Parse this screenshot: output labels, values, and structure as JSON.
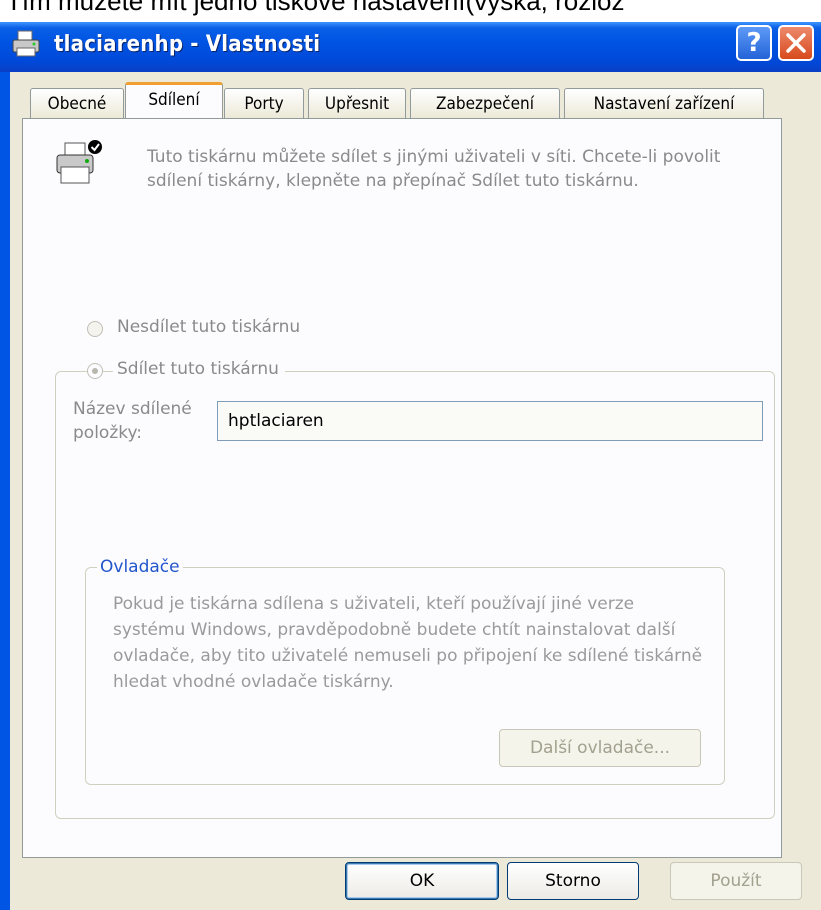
{
  "top_text": "Tím můžete mít jedno tiskové nastavení(výška, rozlož",
  "window": {
    "title": "tlaciarenhp - Vlastnosti",
    "help_label": "?",
    "close_label": "×"
  },
  "tabs": [
    {
      "label": "Obecné",
      "active": false
    },
    {
      "label": "Sdílení",
      "active": true
    },
    {
      "label": "Porty",
      "active": false
    },
    {
      "label": "Upřesnit",
      "active": false
    },
    {
      "label": "Zabezpečení",
      "active": false
    },
    {
      "label": "Nastavení zařízení",
      "active": false
    }
  ],
  "sharing": {
    "info_text": "Tuto tiskárnu můžete sdílet s jinými uživateli v síti. Chcete-li povolit sdílení tiskárny, klepněte na přepínač Sdílet tuto tiskárnu.",
    "radio_no_share": "Nesdílet tuto tiskárnu",
    "radio_share": "Sdílet tuto tiskárnu",
    "share_name_label_line1": "Název sdílené",
    "share_name_label_line2": "položky:",
    "share_name_value": "hptlaciaren"
  },
  "drivers": {
    "title": "Ovladače",
    "text": "Pokud je tiskárna sdílena s uživateli, kteří používají jiné verze systému Windows, pravděpodobně budete chtít nainstalovat další ovladače, aby tito uživatelé nemuseli po připojení ke sdílené tiskárně hledat vhodné ovladače tiskárny.",
    "button_label": "Další ovladače..."
  },
  "footer": {
    "ok_label": "OK",
    "cancel_label": "Storno",
    "apply_label": "Použít"
  },
  "colors": {
    "titlebar": "#0054e3",
    "dialog_bg": "#ece9d8",
    "tab_accent": "#f0a030",
    "groupbox_title": "#2255cc"
  }
}
